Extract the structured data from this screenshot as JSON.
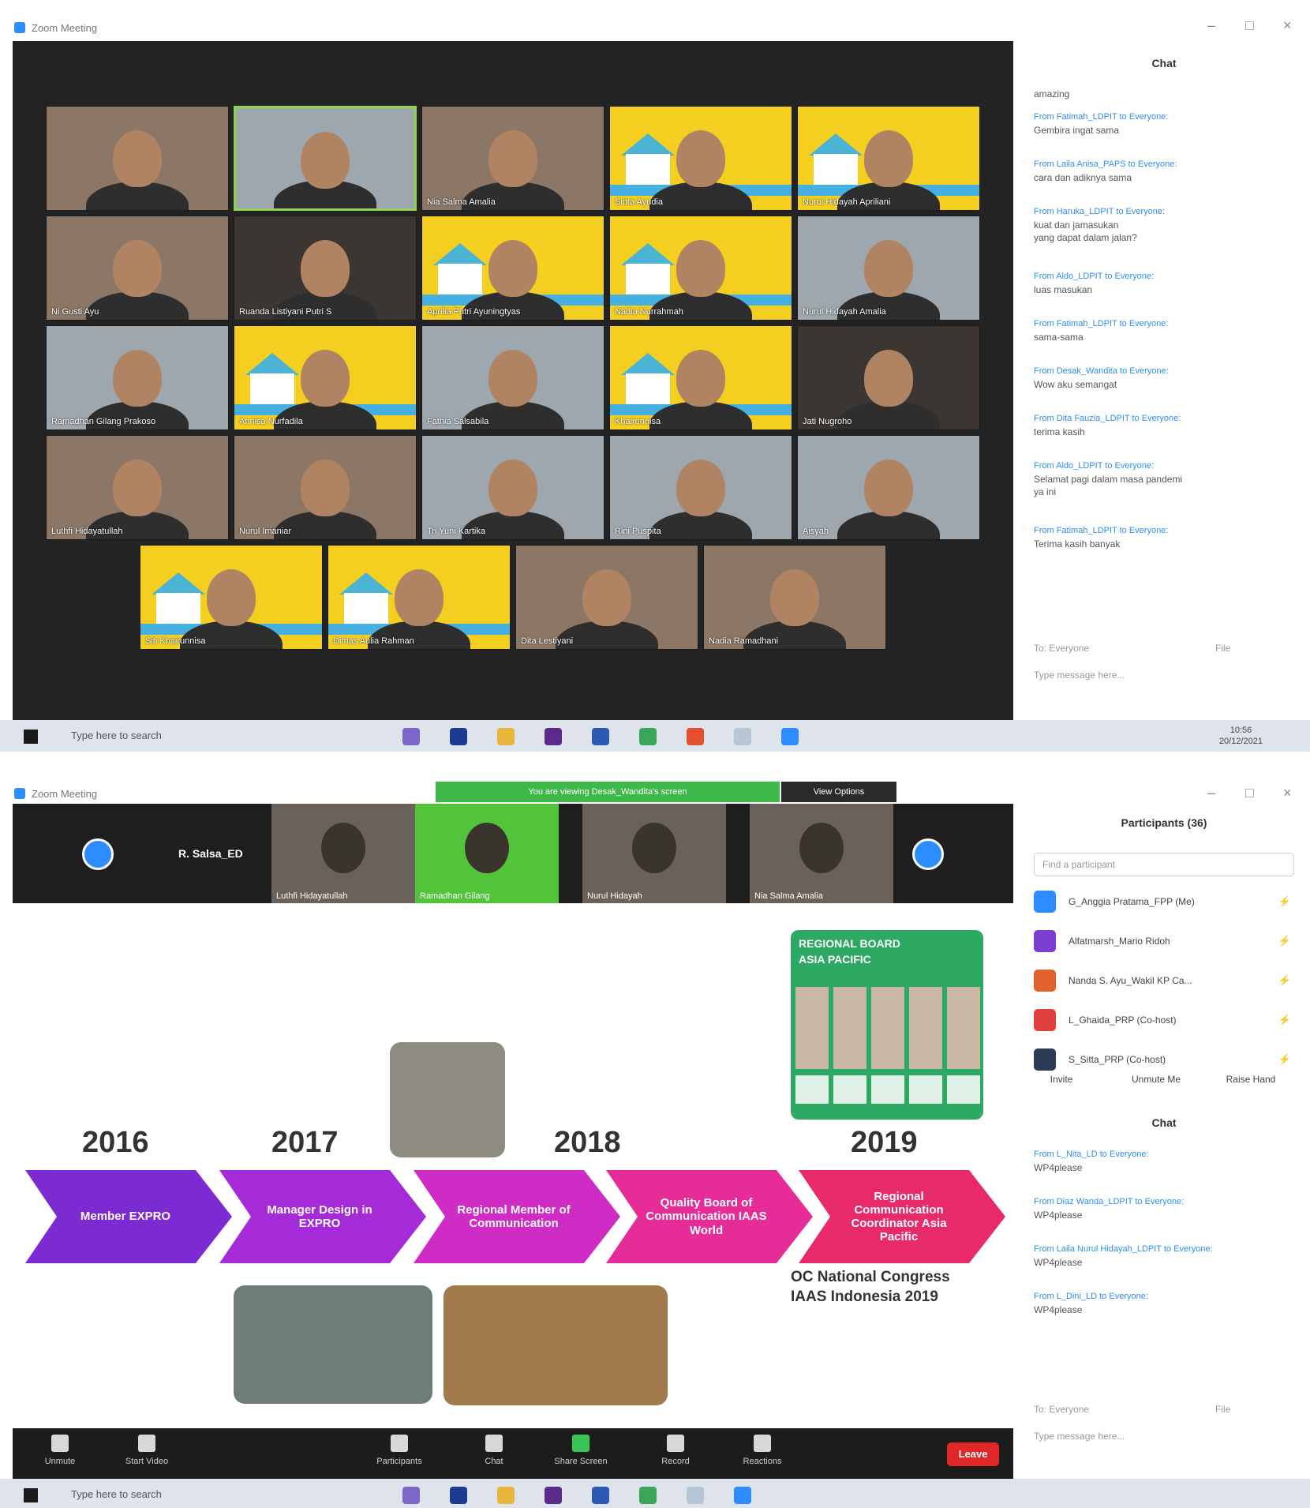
{
  "shot1": {
    "window_title": "Zoom Meeting",
    "win_controls": [
      "–",
      "□",
      "×"
    ],
    "participants": [
      {
        "name": "",
        "style": "warm"
      },
      {
        "name": "",
        "style": "cool",
        "active": true
      },
      {
        "name": "Nia Salma Amalia",
        "style": "warm"
      },
      {
        "name": "Sinta Ayudia",
        "style": "yellow"
      },
      {
        "name": "Nurul Hidayah Apriliani",
        "style": "yellow"
      },
      {
        "name": "Ni Gusti Ayu",
        "style": "warm"
      },
      {
        "name": "Ruanda Listiyani Putri S",
        "style": "dark"
      },
      {
        "name": "Aprilia Putri Ayuningtyas",
        "style": "yellow"
      },
      {
        "name": "Nadia Nurrahmah",
        "style": "yellow"
      },
      {
        "name": "Nurul Hidayah Amalia",
        "style": "cool"
      },
      {
        "name": "Ramadhan Gilang Prakoso",
        "style": "cool"
      },
      {
        "name": "Annisa Nurfadila",
        "style": "yellow"
      },
      {
        "name": "Fathia Salsabila",
        "style": "cool"
      },
      {
        "name": "Khairunnisa",
        "style": "yellow"
      },
      {
        "name": "Jati Nugroho",
        "style": "dark"
      },
      {
        "name": "Luthfi Hidayatullah",
        "style": "warm"
      },
      {
        "name": "Nurul Imaniar",
        "style": "warm"
      },
      {
        "name": "Tri Yuni Kartika",
        "style": "cool"
      },
      {
        "name": "Rini Puspita",
        "style": "cool"
      },
      {
        "name": "Aisyah",
        "style": "cool"
      },
      {
        "name": "Siti Khairunnisa",
        "style": "yellow"
      },
      {
        "name": "Dimas Aulia Rahman",
        "style": "yellow"
      },
      {
        "name": "Dita Lestiyani",
        "style": "warm"
      },
      {
        "name": "Nadia Ramadhani",
        "style": "warm"
      }
    ],
    "chat": {
      "title": "Chat",
      "first_line": "amazing",
      "messages": [
        {
          "from": "From Fatimah_LDPIT to Everyone:",
          "text": "Gembira ingat sama"
        },
        {
          "from": "From Laila Anisa_PAPS to Everyone:",
          "text": "cara dan adiknya sama"
        },
        {
          "from": "From Haruka_LDPIT to Everyone:",
          "text": "kuat dan jamasukan\nyang dapat dalam jalan?"
        },
        {
          "from": "From Aldo_LDPIT to Everyone:",
          "text": "luas masukan"
        },
        {
          "from": "From Fatimah_LDPIT to Everyone:",
          "text": "sama-sama"
        },
        {
          "from": "From Desak_Wandita to Everyone:",
          "text": "Wow aku semangat"
        },
        {
          "from": "From Dita Fauzia_LDPIT to Everyone:",
          "text": "terima kasih"
        },
        {
          "from": "From Aldo_LDPIT to Everyone:",
          "text": "Selamat pagi dalam masa pandemi\nya ini"
        },
        {
          "from": "From Fatimah_LDPIT to Everyone:",
          "text": "Terima kasih banyak"
        }
      ],
      "to_label": "To: Everyone",
      "file_label": "File",
      "placeholder": "Type message here..."
    },
    "taskbar": {
      "search": "Type here to search",
      "time": "10:56",
      "date": "20/12/2021"
    }
  },
  "shot2": {
    "window_title": "Zoom Meeting",
    "win_controls": [
      "–",
      "□",
      "×"
    ],
    "banner": "You are viewing Desak_Wandita's screen",
    "view_options": "View Options",
    "strip_name": "R. Salsa_ED",
    "strip_tiles": [
      {
        "name": "Luthfi Hidayatullah",
        "style": "warm"
      },
      {
        "name": "Ramadhan Gilang",
        "style": "green"
      },
      {
        "name": "Nurul Hidayah",
        "style": "dark"
      },
      {
        "name": "Nia Salma Amalia",
        "style": "warm"
      }
    ],
    "slide": {
      "years": [
        "2016",
        "2017",
        "2018",
        "2019"
      ],
      "steps": [
        "Member EXPRO",
        "Manager Design in EXPRO",
        "Regional Member of Communication",
        "Quality Board of Communication IAAS World",
        "Regional Communication Coordinator Asia Pacific"
      ],
      "step_colors": [
        "#7b2bd1",
        "#a52ad8",
        "#cf2cc6",
        "#e62c96",
        "#e82a6c"
      ],
      "green_panel_title": "REGIONAL BOARD\nASIA PACIFIC",
      "caption": "OC National Congress\nIAAS Indonesia 2019"
    },
    "controls": [
      {
        "label": "Unmute",
        "color": "normal"
      },
      {
        "label": "Start Video",
        "color": "normal"
      },
      {
        "label": "Participants",
        "color": "normal"
      },
      {
        "label": "Chat",
        "color": "normal"
      },
      {
        "label": "Share Screen",
        "color": "green"
      },
      {
        "label": "Record",
        "color": "normal"
      },
      {
        "label": "Reactions",
        "color": "normal"
      }
    ],
    "end_label": "Leave",
    "participants_panel": {
      "title": "Participants (36)",
      "search_placeholder": "Find a participant",
      "rows": [
        {
          "name": "G_Anggia Pratama_FPP (Me)",
          "color": "#2d8cff"
        },
        {
          "name": "Alfatmarsh_Mario Ridoh",
          "color": "#7a3fd1"
        },
        {
          "name": "Nanda S. Ayu_Wakil KP Ca...",
          "color": "#e0632d"
        },
        {
          "name": "L_Ghaida_PRP (Co-host)",
          "color": "#e04040"
        },
        {
          "name": "S_Sitta_PRP (Co-host)",
          "color": "#2b3a55"
        }
      ],
      "buttons": [
        "Invite",
        "Unmute Me",
        "Raise Hand"
      ]
    },
    "chat2": {
      "title": "Chat",
      "messages": [
        {
          "from": "From L_Nita_LD to Everyone:",
          "text": "WP4please"
        },
        {
          "from": "From Diaz Wanda_LDPIT to Everyone:",
          "text": "WP4please"
        },
        {
          "from": "From Laila Nurul Hidayah_LDPIT to Everyone:",
          "text": "WP4please"
        },
        {
          "from": "From L_Dini_LD to Everyone:",
          "text": "WP4please"
        }
      ],
      "to_label": "To: Everyone",
      "file_label": "File",
      "placeholder": "Type message here..."
    },
    "taskbar": {
      "search": "Type here to search"
    }
  }
}
